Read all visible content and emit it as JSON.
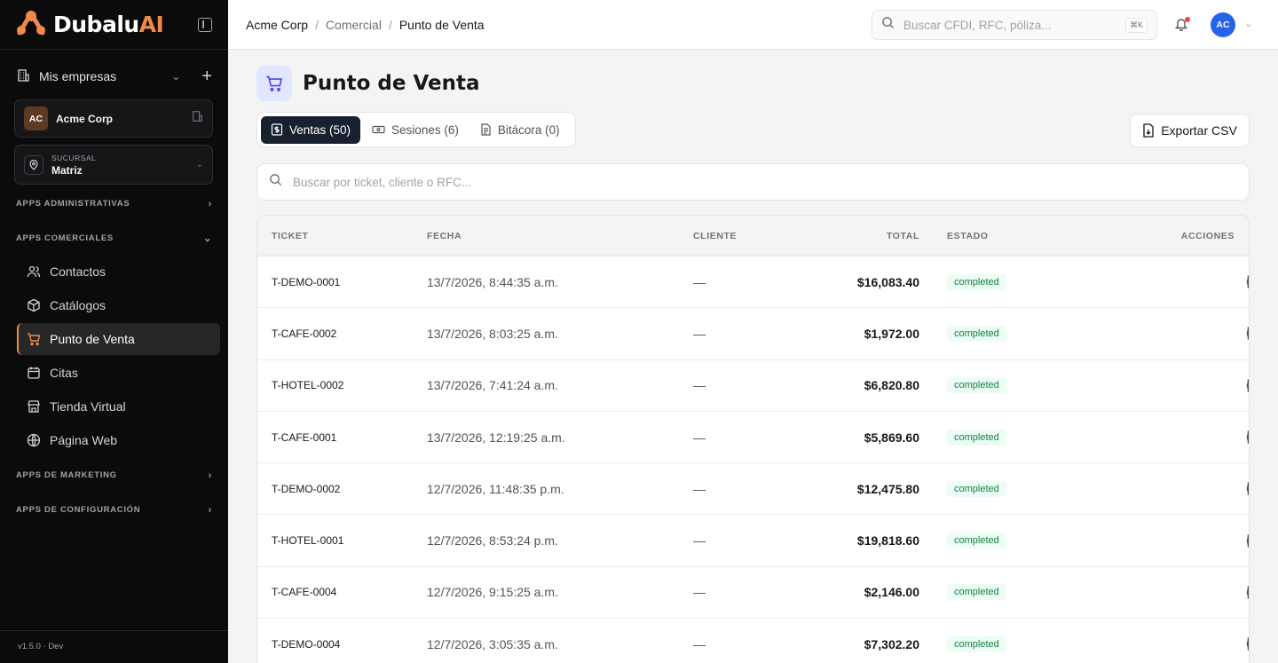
{
  "brand": {
    "name_main": "Dubalu",
    "name_accent": "AI",
    "accent_color": "#f08a4b"
  },
  "sidebar": {
    "companies_label": "Mis empresas",
    "company": {
      "initials": "AC",
      "name": "Acme Corp"
    },
    "branch": {
      "label": "SUCURSAL",
      "value": "Matriz"
    },
    "sections": [
      {
        "label": "APPS ADMINISTRATIVAS",
        "expanded": false
      },
      {
        "label": "APPS COMERCIALES",
        "expanded": true
      },
      {
        "label": "APPS DE MARKETING",
        "expanded": false
      },
      {
        "label": "APPS DE CONFIGURACIÓN",
        "expanded": false
      }
    ],
    "items": [
      {
        "label": "Contactos",
        "icon": "users-icon"
      },
      {
        "label": "Catálogos",
        "icon": "box-icon"
      },
      {
        "label": "Punto de Venta",
        "icon": "cart-icon",
        "active": true
      },
      {
        "label": "Citas",
        "icon": "calendar-icon"
      },
      {
        "label": "Tienda Virtual",
        "icon": "store-icon"
      },
      {
        "label": "Página Web",
        "icon": "globe-icon"
      }
    ],
    "footer": "v1.5.0 · Dev"
  },
  "topbar": {
    "breadcrumb": [
      "Acme Corp",
      "Comercial",
      "Punto de Venta"
    ],
    "search_placeholder": "Buscar CFDI, RFC, póliza...",
    "search_shortcut": "⌘K",
    "avatar_initials": "AC",
    "has_notification": true
  },
  "page": {
    "title": "Punto de Venta",
    "tabs": [
      {
        "label": "Ventas (50)",
        "active": true
      },
      {
        "label": "Sesiones (6)"
      },
      {
        "label": "Bitácora (0)"
      }
    ],
    "export_label": "Exportar CSV",
    "search_placeholder": "Buscar por ticket, cliente o RFC..."
  },
  "table": {
    "columns": [
      "TICKET",
      "FECHA",
      "CLIENTE",
      "TOTAL",
      "ESTADO",
      "ACCIONES"
    ],
    "rows": [
      {
        "ticket": "T-DEMO-0001",
        "fecha": "13/7/2026, 8:44:35 a.m.",
        "cliente": "—",
        "total": "$16,083.40",
        "estado": "completed"
      },
      {
        "ticket": "T-CAFE-0002",
        "fecha": "13/7/2026, 8:03:25 a.m.",
        "cliente": "—",
        "total": "$1,972.00",
        "estado": "completed"
      },
      {
        "ticket": "T-HOTEL-0002",
        "fecha": "13/7/2026, 7:41:24 a.m.",
        "cliente": "—",
        "total": "$6,820.80",
        "estado": "completed"
      },
      {
        "ticket": "T-CAFE-0001",
        "fecha": "13/7/2026, 12:19:25 a.m.",
        "cliente": "—",
        "total": "$5,869.60",
        "estado": "completed"
      },
      {
        "ticket": "T-DEMO-0002",
        "fecha": "12/7/2026, 11:48:35 p.m.",
        "cliente": "—",
        "total": "$12,475.80",
        "estado": "completed"
      },
      {
        "ticket": "T-HOTEL-0001",
        "fecha": "12/7/2026, 8:53:24 p.m.",
        "cliente": "—",
        "total": "$19,818.60",
        "estado": "completed"
      },
      {
        "ticket": "T-CAFE-0004",
        "fecha": "12/7/2026, 9:15:25 a.m.",
        "cliente": "—",
        "total": "$2,146.00",
        "estado": "completed"
      },
      {
        "ticket": "T-DEMO-0004",
        "fecha": "12/7/2026, 3:05:35 a.m.",
        "cliente": "—",
        "total": "$7,302.20",
        "estado": "completed"
      }
    ],
    "row_actions": [
      "refund-icon",
      "invoice-icon",
      "cancel-icon"
    ]
  }
}
